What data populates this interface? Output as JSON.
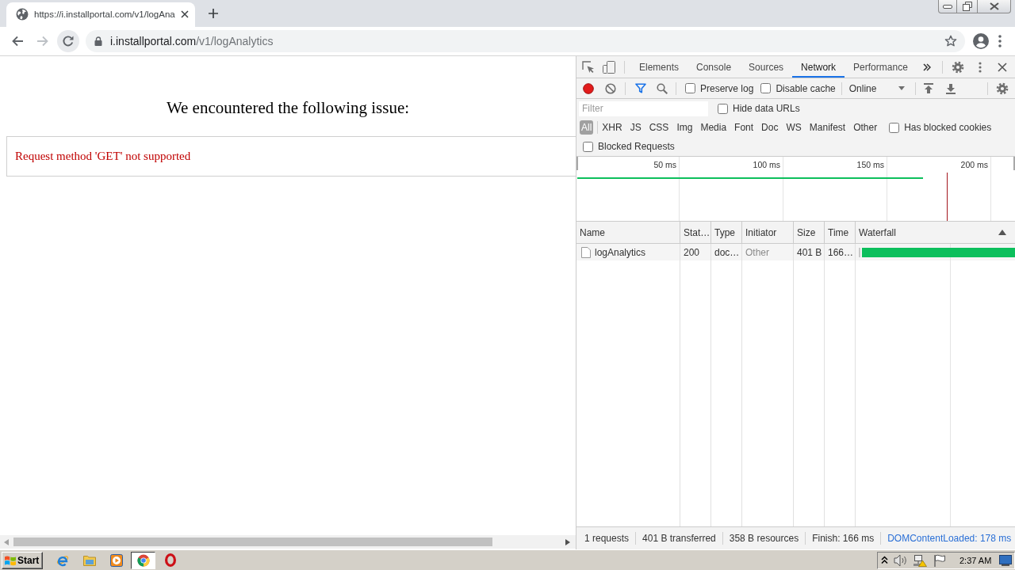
{
  "browser": {
    "tabs": [
      {
        "title": "https://i.installportal.com/v1/logAna",
        "selected": true
      }
    ],
    "address_bar": {
      "host": "i.installportal.com",
      "path": "/v1/logAnalytics"
    }
  },
  "page": {
    "heading": "We encountered the following issue:",
    "error": "Request method 'GET' not supported"
  },
  "devtools": {
    "panels": [
      {
        "label": "Elements",
        "selected": false
      },
      {
        "label": "Console",
        "selected": false
      },
      {
        "label": "Sources",
        "selected": false
      },
      {
        "label": "Network",
        "selected": true
      },
      {
        "label": "Performance",
        "selected": false
      }
    ],
    "recording": true,
    "toolbar_options": [
      {
        "label": "Preserve log",
        "checked": false
      },
      {
        "label": "Disable cache",
        "checked": false
      }
    ],
    "throttling": "Online",
    "filter": {
      "placeholder": "Filter"
    },
    "hide_data_urls": {
      "label": "Hide data URLs",
      "checked": false
    },
    "types": [
      {
        "label": "All",
        "selected": true
      },
      {
        "label": "XHR",
        "selected": false
      },
      {
        "label": "JS",
        "selected": false
      },
      {
        "label": "CSS",
        "selected": false
      },
      {
        "label": "Img",
        "selected": false
      },
      {
        "label": "Media",
        "selected": false
      },
      {
        "label": "Font",
        "selected": false
      },
      {
        "label": "Doc",
        "selected": false
      },
      {
        "label": "WS",
        "selected": false
      },
      {
        "label": "Manifest",
        "selected": false
      },
      {
        "label": "Other",
        "selected": false
      }
    ],
    "has_blocked_cookies": {
      "label": "Has blocked cookies",
      "checked": false
    },
    "blocked_requests": {
      "label": "Blocked Requests",
      "checked": false
    },
    "overview": {
      "ticks": [
        "50 ms",
        "100 ms",
        "150 ms",
        "200 ms"
      ]
    },
    "columns": [
      {
        "label": "Name",
        "sorted": false
      },
      {
        "label": "Stat…",
        "sorted": false
      },
      {
        "label": "Type",
        "sorted": false
      },
      {
        "label": "Initiator",
        "sorted": false
      },
      {
        "label": "Size",
        "sorted": false
      },
      {
        "label": "Time",
        "sorted": false
      },
      {
        "label": "Waterfall",
        "sorted": true
      }
    ],
    "rows": [
      {
        "name": "logAnalytics",
        "status": "200",
        "type": "doc…",
        "initiator": "Other",
        "size": "401 B",
        "time": "166…",
        "selected": false
      }
    ],
    "summary": [
      {
        "text": "1 requests",
        "kind": "text"
      },
      {
        "text": "401 B transferred",
        "kind": "text"
      },
      {
        "text": "358 B resources",
        "kind": "text"
      },
      {
        "text": "Finish: 166 ms",
        "kind": "text"
      },
      {
        "text": "DOMContentLoaded: 178 ms",
        "kind": "link"
      }
    ]
  },
  "taskbar": {
    "start": "Start",
    "apps": [
      {
        "kind": "e-letter",
        "active": false
      },
      {
        "kind": "folder",
        "active": false
      },
      {
        "kind": "play",
        "active": false
      },
      {
        "kind": "tricolor-circle",
        "active": true
      },
      {
        "kind": "o-letter",
        "active": false
      }
    ],
    "clock": "2:37 AM"
  }
}
